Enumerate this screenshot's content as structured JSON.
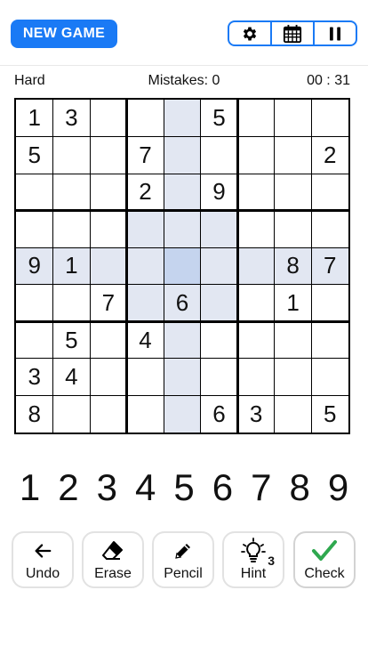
{
  "header": {
    "new_game_label": "NEW GAME",
    "tools": [
      {
        "icon": "gear-icon"
      },
      {
        "icon": "calendar-icon"
      },
      {
        "icon": "pause-icon"
      }
    ]
  },
  "status": {
    "difficulty": "Hard",
    "mistakes": "Mistakes: 0",
    "timer": "00 : 31"
  },
  "board": {
    "selected_row": 4,
    "selected_col": 4,
    "colors": {
      "highlight": "#e2e7f2",
      "selected": "#c5d4ee",
      "accent": "#1a7af5",
      "check_green": "#2fa84f"
    },
    "grid": [
      [
        "1",
        "3",
        "",
        "",
        "",
        "5",
        "",
        "",
        ""
      ],
      [
        "5",
        "",
        "",
        "7",
        "",
        "",
        "",
        "",
        "2"
      ],
      [
        "",
        "",
        "",
        "2",
        "",
        "9",
        "",
        "",
        ""
      ],
      [
        "",
        "",
        "",
        "",
        "",
        "",
        "",
        "",
        ""
      ],
      [
        "9",
        "1",
        "",
        "",
        "",
        "",
        "",
        "8",
        "7"
      ],
      [
        "",
        "",
        "7",
        "",
        "6",
        "",
        "",
        "1",
        ""
      ],
      [
        "",
        "5",
        "",
        "4",
        "",
        "",
        "",
        "",
        ""
      ],
      [
        "3",
        "4",
        "",
        "",
        "",
        "",
        "",
        "",
        ""
      ],
      [
        "8",
        "",
        "",
        "",
        "",
        "6",
        "3",
        "",
        "5"
      ]
    ]
  },
  "numpad": [
    "1",
    "2",
    "3",
    "4",
    "5",
    "6",
    "7",
    "8",
    "9"
  ],
  "actions": [
    {
      "label": "Undo",
      "icon": "undo-arrow-icon"
    },
    {
      "label": "Erase",
      "icon": "eraser-icon"
    },
    {
      "label": "Pencil",
      "icon": "pencil-icon"
    },
    {
      "label": "Hint",
      "icon": "lightbulb-icon",
      "badge": "3"
    },
    {
      "label": "Check",
      "icon": "checkmark-icon"
    }
  ]
}
